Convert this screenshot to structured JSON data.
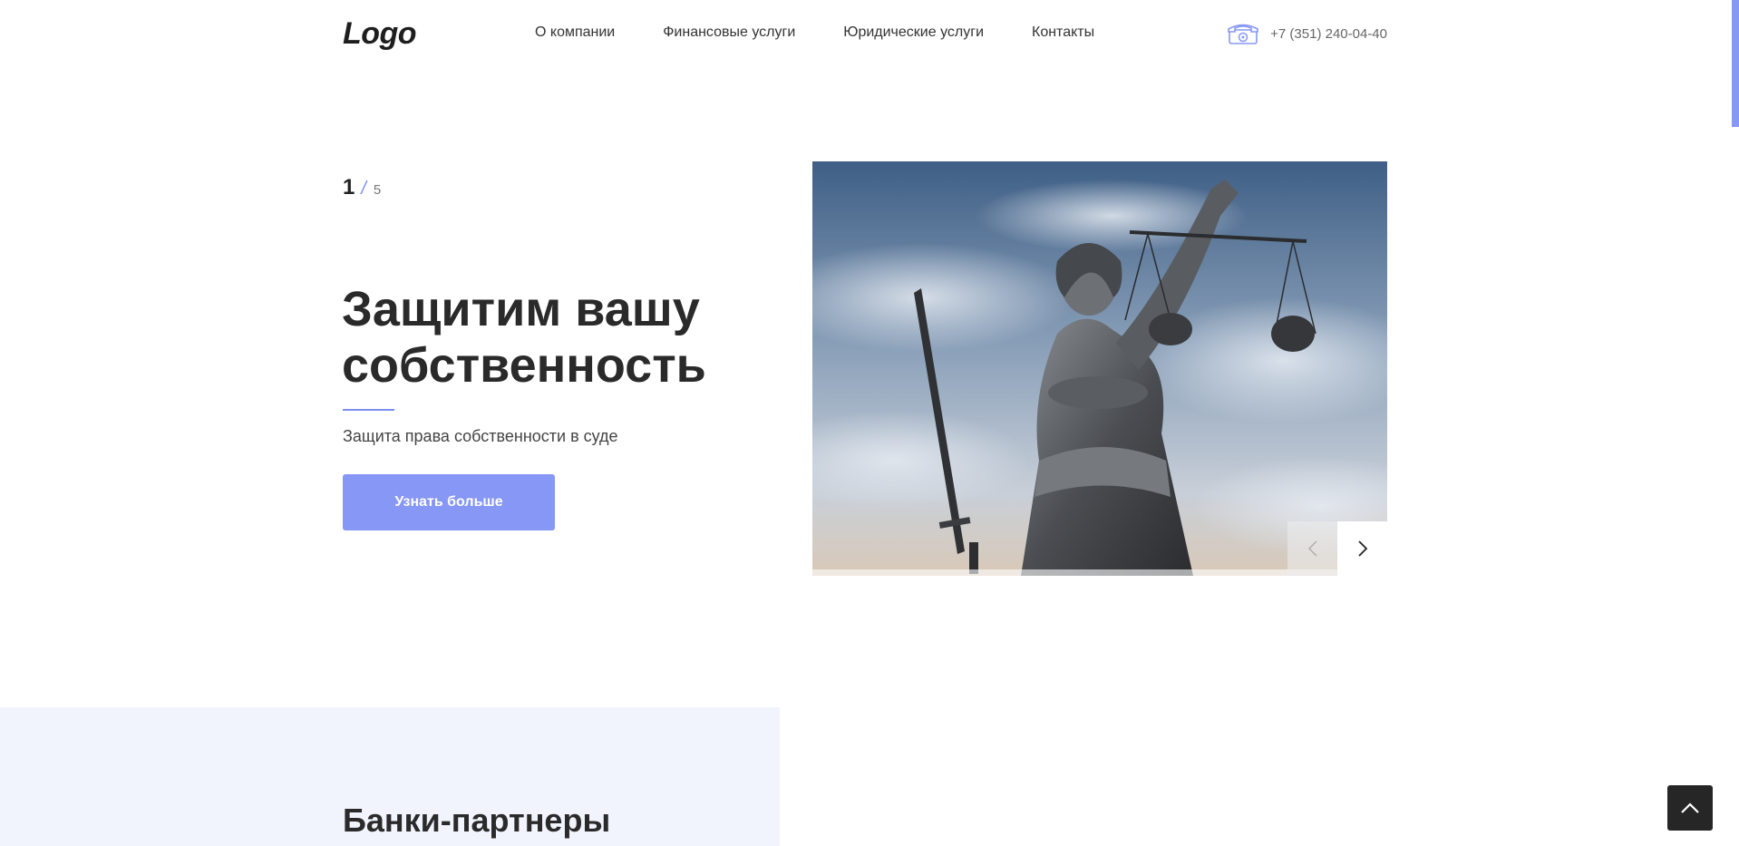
{
  "header": {
    "logo": "Logo",
    "nav": [
      {
        "label": "О компании",
        "active": true
      },
      {
        "label": "Финансовые услуги",
        "active": false
      },
      {
        "label": "Юридические услуги",
        "active": false
      },
      {
        "label": "Контакты",
        "active": false
      }
    ],
    "phone": "+7 (351) 240-04-40",
    "phone_icon": "telephone-icon"
  },
  "slider": {
    "current": "1",
    "separator": "/",
    "total": "5",
    "title": "Защитим вашу собственность",
    "subtitle": "Защита права собственности в суде",
    "button_label": "Узнать больше",
    "image_icon": "lady-justice-statue-image",
    "prev_icon": "chevron-left-icon",
    "next_icon": "chevron-right-icon"
  },
  "partners": {
    "title": "Банки-партнеры"
  },
  "to_top_icon": "chevron-up-icon",
  "colors": {
    "accent": "#8797f5",
    "text": "#2a2a2a",
    "partners_bg": "#f1f3fd",
    "to_top_bg": "#262626"
  }
}
